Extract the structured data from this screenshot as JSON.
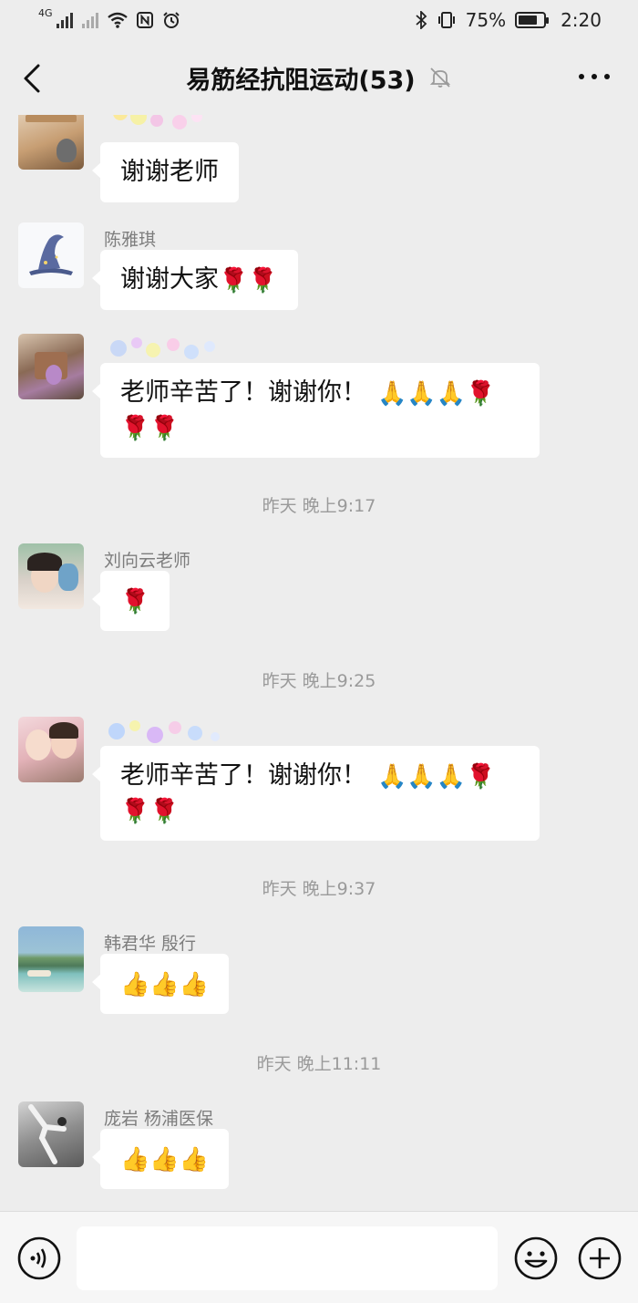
{
  "status": {
    "network": "4G",
    "battery": "75%",
    "battery_level": 0.75,
    "time": "2:20",
    "icons": [
      "signal-icon",
      "wifi-icon",
      "nfc-icon",
      "alarm-icon",
      "bluetooth-icon",
      "vibrate-icon",
      "battery-icon"
    ]
  },
  "header": {
    "title": "易筋经抗阻运动(53)",
    "icons": [
      "back-icon",
      "mute-bell-icon",
      "more-icon"
    ]
  },
  "messages": [
    {
      "sender": "",
      "text": "谢谢老师",
      "emojis": ""
    },
    {
      "sender": "陈雅琪",
      "text": "谢谢大家",
      "emojis": "🌹🌹"
    },
    {
      "sender": "",
      "text": "老师辛苦了！谢谢你！",
      "emojis": "🙏🙏🙏🌹",
      "emojis_line2": "🌹🌹"
    },
    {
      "time": "昨天 晚上9:17"
    },
    {
      "sender": "刘向云老师",
      "text": "",
      "emojis": "🌹"
    },
    {
      "time": "昨天 晚上9:25"
    },
    {
      "sender": "",
      "text": "老师辛苦了！谢谢你！",
      "emojis": "🙏🙏🙏🌹",
      "emojis_line2": "🌹🌹"
    },
    {
      "time": "昨天 晚上9:37"
    },
    {
      "sender": "韩君华 殷行",
      "text": "",
      "emojis": "👍👍👍"
    },
    {
      "time": "昨天 晚上11:11"
    },
    {
      "sender": "庞岩 杨浦医保",
      "text": "",
      "emojis": "👍👍👍"
    }
  ],
  "input_bar": {
    "input_value": "",
    "icons": [
      "voice-icon",
      "emoji-icon",
      "plus-icon"
    ]
  },
  "colors": {
    "background": "#ededed",
    "bubble": "#ffffff",
    "name": "#7d7d7d",
    "timestamp": "#9a9a9a"
  }
}
